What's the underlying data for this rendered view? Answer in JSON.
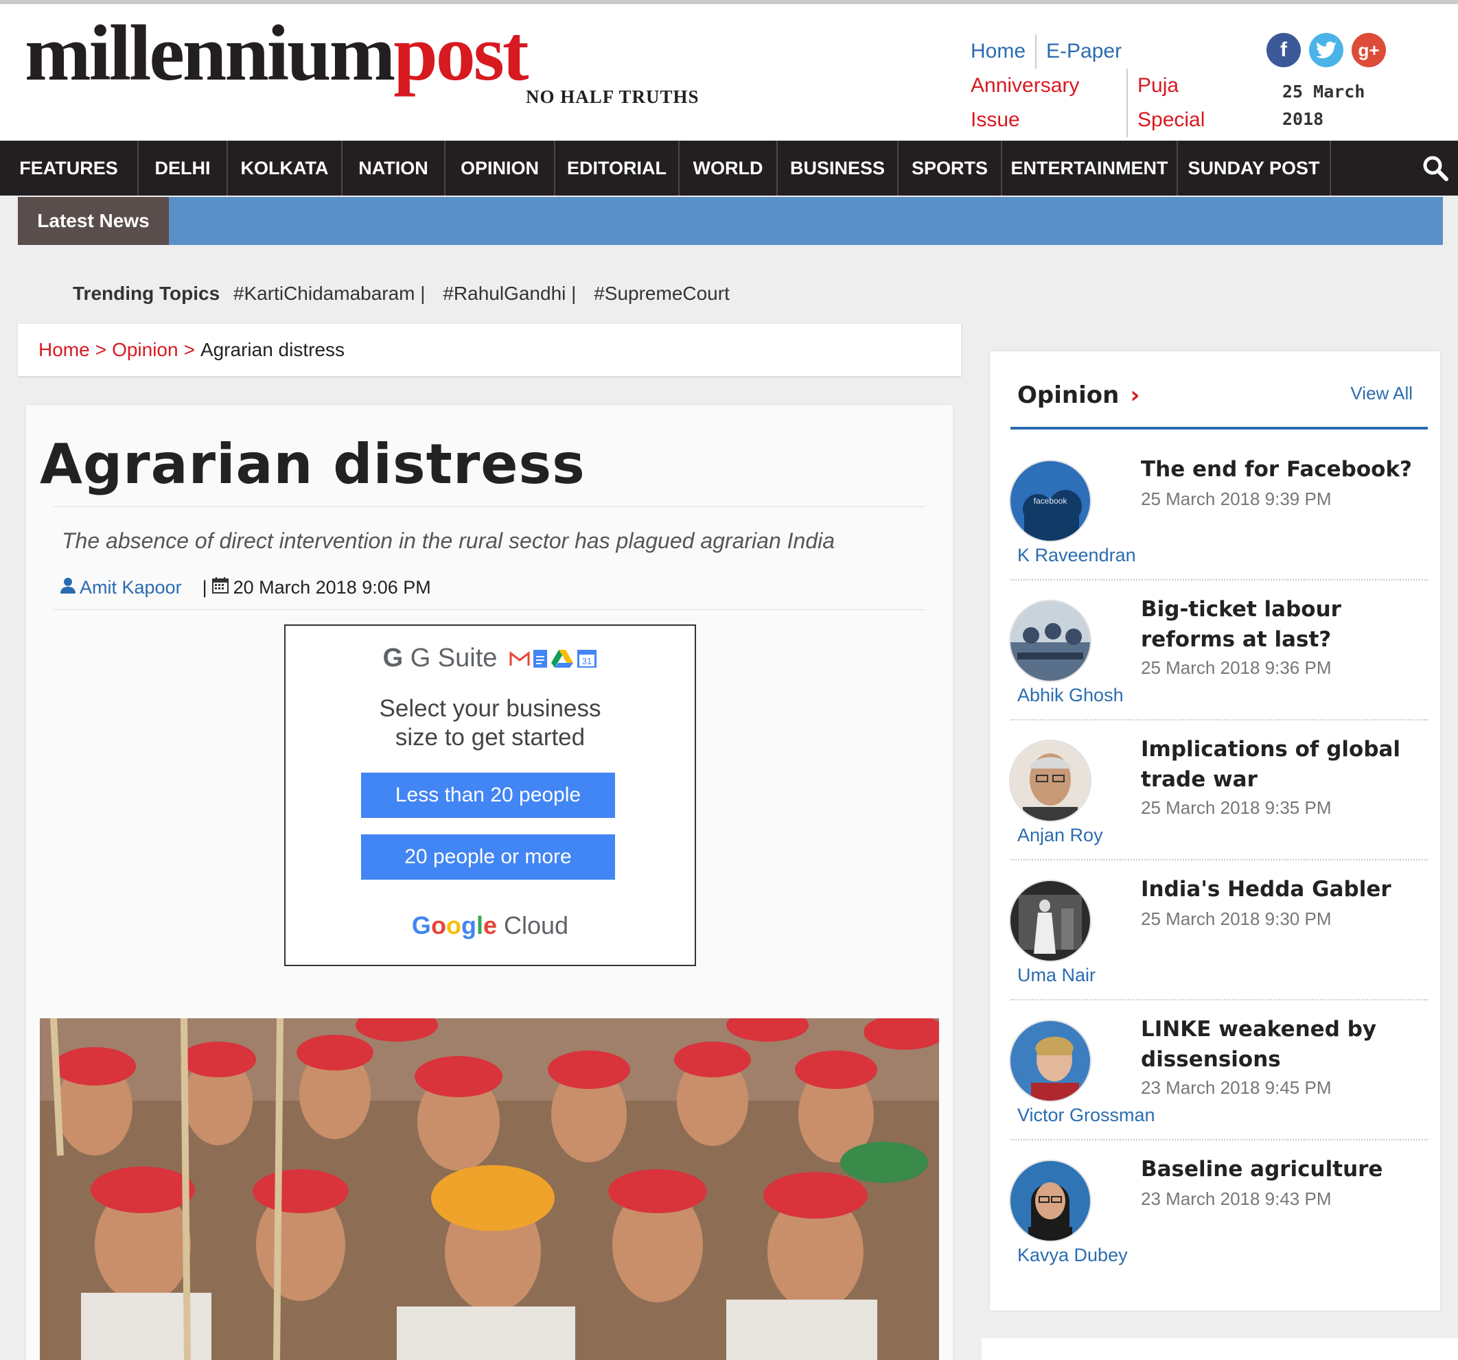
{
  "brand": {
    "logo_part1": "millennium",
    "logo_part2": "post",
    "tagline": "NO HALF TRUTHS",
    "primary_color": "#d71920",
    "dark_color": "#231f20",
    "link_color": "#2a6cb0"
  },
  "toplinks": {
    "home": "Home",
    "epaper": "E-Paper",
    "anniversary": "Anniversary Issue",
    "puja": "Puja Special"
  },
  "social": {
    "facebook": "f",
    "twitter": "t",
    "googleplus": "g+"
  },
  "header_date": "25 March 2018",
  "nav": [
    "FEATURES",
    "DELHI",
    "KOLKATA",
    "NATION",
    "OPINION",
    "EDITORIAL",
    "WORLD",
    "BUSINESS",
    "SPORTS",
    "ENTERTAINMENT",
    "SUNDAY POST"
  ],
  "latest_news_label": "Latest News",
  "trending": {
    "label": "Trending Topics",
    "tags": [
      "#KartiChidamabaram |",
      "#RahulGandhi |",
      "#SupremeCourt"
    ]
  },
  "breadcrumb": {
    "home": "Home",
    "section": "Opinion",
    "current": "Agrarian distress"
  },
  "article": {
    "title": "Agrarian distress",
    "subtitle": "The absence of direct intervention in the rural sector has plagued agrarian India",
    "author": "Amit Kapoor",
    "date": "20 March 2018 9:06 PM"
  },
  "ad": {
    "gsuite": "G Suite",
    "calendar_day": "31",
    "line1": "Select your business",
    "line2": "size to get started",
    "btn1": "Less than 20 people",
    "btn2": "20 people or more",
    "footer_google": "Google",
    "footer_cloud": "Cloud"
  },
  "sidebar": {
    "heading": "Opinion",
    "view_all": "View All",
    "items": [
      {
        "title": "The end for Facebook?",
        "date": "25 March 2018 9:39 PM",
        "author": "K Raveendran",
        "avatar": "facebook-thumbnail",
        "avatar_text": "facebook"
      },
      {
        "title": "Big-ticket labour reforms at last?",
        "date": "25 March 2018 9:36 PM",
        "author": "Abhik Ghosh",
        "avatar": "workers-thumbnail"
      },
      {
        "title": "Implications of global trade war",
        "date": "25 March 2018 9:35 PM",
        "author": "Anjan Roy",
        "avatar": "author-portrait"
      },
      {
        "title": "India's Hedda Gabler",
        "date": "25 March 2018 9:30 PM",
        "author": "Uma Nair",
        "avatar": "stage-thumbnail"
      },
      {
        "title": "LINKE weakened by dissensions",
        "date": "23 March 2018 9:45 PM",
        "author": "Victor Grossman",
        "avatar": "politician-thumbnail"
      },
      {
        "title": "Baseline agriculture",
        "date": "23 March 2018 9:43 PM",
        "author": "Kavya Dubey",
        "avatar": "author-portrait"
      }
    ]
  }
}
